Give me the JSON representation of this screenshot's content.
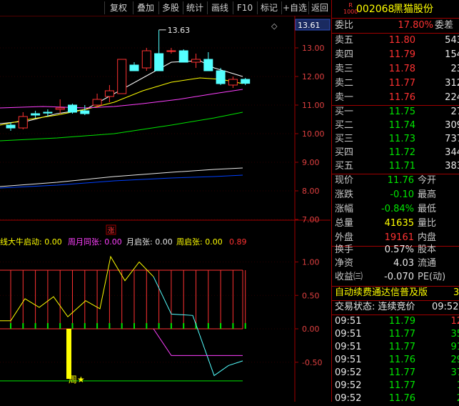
{
  "toolbar": {
    "buttons": [
      "复权",
      "叠加",
      "多股",
      "统计",
      "画线",
      "F10",
      "标记",
      "+自选",
      "返回"
    ]
  },
  "price_chart": {
    "high_label": "13.63",
    "last_price": "13.61",
    "yticks": [
      "13.00",
      "12.00",
      "11.00",
      "10.00",
      "9.00",
      "8.00",
      "7.00"
    ],
    "diamond": "◇",
    "candles": [
      {
        "o": 10.3,
        "c": 10.2,
        "h": 10.4,
        "l": 10.1
      },
      {
        "o": 10.2,
        "c": 10.6,
        "h": 10.75,
        "l": 10.15
      },
      {
        "o": 10.7,
        "c": 10.65,
        "h": 10.8,
        "l": 10.55
      },
      {
        "o": 10.75,
        "c": 10.72,
        "h": 10.85,
        "l": 10.6
      },
      {
        "o": 10.85,
        "c": 10.9,
        "h": 11.2,
        "l": 10.7
      },
      {
        "o": 11.0,
        "c": 10.75,
        "h": 11.05,
        "l": 10.7
      },
      {
        "o": 10.8,
        "c": 10.7,
        "h": 11.0,
        "l": 10.65
      },
      {
        "o": 11.0,
        "c": 11.2,
        "h": 11.4,
        "l": 10.9
      },
      {
        "o": 11.3,
        "c": 11.5,
        "h": 11.7,
        "l": 11.1
      },
      {
        "o": 11.4,
        "c": 12.6,
        "h": 12.6,
        "l": 11.4
      },
      {
        "o": 12.4,
        "c": 12.2,
        "h": 12.5,
        "l": 12.2
      },
      {
        "o": 12.3,
        "c": 12.9,
        "h": 13.0,
        "l": 12.2
      },
      {
        "o": 12.8,
        "c": 12.2,
        "h": 13.63,
        "l": 12.2
      },
      {
        "o": 12.9,
        "c": 12.9,
        "h": 13.0,
        "l": 12.8
      },
      {
        "o": 12.9,
        "c": 12.5,
        "h": 12.95,
        "l": 12.5
      },
      {
        "o": 12.5,
        "c": 12.6,
        "h": 12.8,
        "l": 12.3
      },
      {
        "o": 12.6,
        "c": 12.2,
        "h": 12.85,
        "l": 12.2
      },
      {
        "o": 12.2,
        "c": 11.75,
        "h": 12.3,
        "l": 11.7
      },
      {
        "o": 11.7,
        "c": 11.9,
        "h": 12.0,
        "l": 11.6
      },
      {
        "o": 11.9,
        "c": 11.76,
        "h": 11.95,
        "l": 11.7
      }
    ]
  },
  "indicator": {
    "marker": "涨",
    "legend": [
      {
        "label": "线大牛启动: 0.00",
        "color": "#ffff00"
      },
      {
        "label": "周月同张: 0.00",
        "color": "#ff40ff"
      },
      {
        "label": "月启张: 0.00",
        "color": "#e8e8e8"
      },
      {
        "label": "周启张: 0.00",
        "color": "#ffff00"
      },
      {
        "label": "0.89",
        "color": "#ff3232"
      }
    ],
    "yticks": [
      "1.00",
      "0.50",
      "0.00",
      "-0.50"
    ],
    "star_label": "周★"
  },
  "quote": {
    "code": "002068",
    "name": "黑猫股份",
    "badge_top": "R",
    "badge_bottom": "1000",
    "ratio_label": "委比",
    "ratio_value": "17.80%",
    "diff_label": "委差",
    "asks": [
      {
        "label": "卖五",
        "price": "11.80",
        "vol": "543"
      },
      {
        "label": "卖四",
        "price": "11.79",
        "vol": "154"
      },
      {
        "label": "卖三",
        "price": "11.78",
        "vol": "23"
      },
      {
        "label": "卖二",
        "price": "11.77",
        "vol": "312"
      },
      {
        "label": "卖一",
        "price": "11.76",
        "vol": "224"
      }
    ],
    "bids": [
      {
        "label": "买一",
        "price": "11.75",
        "vol": "27"
      },
      {
        "label": "买二",
        "price": "11.74",
        "vol": "309"
      },
      {
        "label": "买三",
        "price": "11.73",
        "vol": "737"
      },
      {
        "label": "买四",
        "price": "11.72",
        "vol": "344"
      },
      {
        "label": "买五",
        "price": "11.71",
        "vol": "383"
      }
    ],
    "stats": [
      {
        "l1": "现价",
        "v1": "11.76",
        "c1": "grn",
        "l2": "今开"
      },
      {
        "l1": "涨跌",
        "v1": "-0.10",
        "c1": "grn",
        "l2": "最高"
      },
      {
        "l1": "涨幅",
        "v1": "-0.84%",
        "c1": "grn",
        "l2": "最低"
      },
      {
        "l1": "总量",
        "v1": "41635",
        "c1": "yel",
        "l2": "量比"
      },
      {
        "l1": "外盘",
        "v1": "19161",
        "c1": "red",
        "l2": "内盘"
      }
    ],
    "stats2": [
      {
        "l1": "换手",
        "v1": "0.57%",
        "l2": "股本"
      },
      {
        "l1": "净资",
        "v1": "4.03",
        "l2": "流通"
      },
      {
        "l1": "收益㈢",
        "v1": "-0.070",
        "l2": "PE(动)"
      }
    ],
    "ticker": "自动续费通达信普及版",
    "ticker_extra": "3",
    "trade_status": "交易状态: 连续竞价",
    "trade_time": "09:52",
    "ticks": [
      {
        "time": "09:51",
        "price": "11.79",
        "vol": "12"
      },
      {
        "time": "09:51",
        "price": "11.77",
        "vol": "35"
      },
      {
        "time": "09:51",
        "price": "11.77",
        "vol": "91"
      },
      {
        "time": "09:51",
        "price": "11.76",
        "vol": "29"
      },
      {
        "time": "09:52",
        "price": "11.77",
        "vol": "37"
      },
      {
        "time": "09:52",
        "price": "11.77",
        "vol": "1"
      },
      {
        "time": "09:52",
        "price": "11.76",
        "vol": "2"
      }
    ]
  },
  "colors": {
    "up": "#ff3232",
    "down": "#00e600",
    "frame": "#a00000",
    "ma5": "#ffffff",
    "ma10": "#ffff00",
    "ma20": "#ff40ff",
    "ma60": "#00e600",
    "ma120": "#e8e8e8",
    "ma250": "#0040ff",
    "cyan": "#54ffff"
  }
}
